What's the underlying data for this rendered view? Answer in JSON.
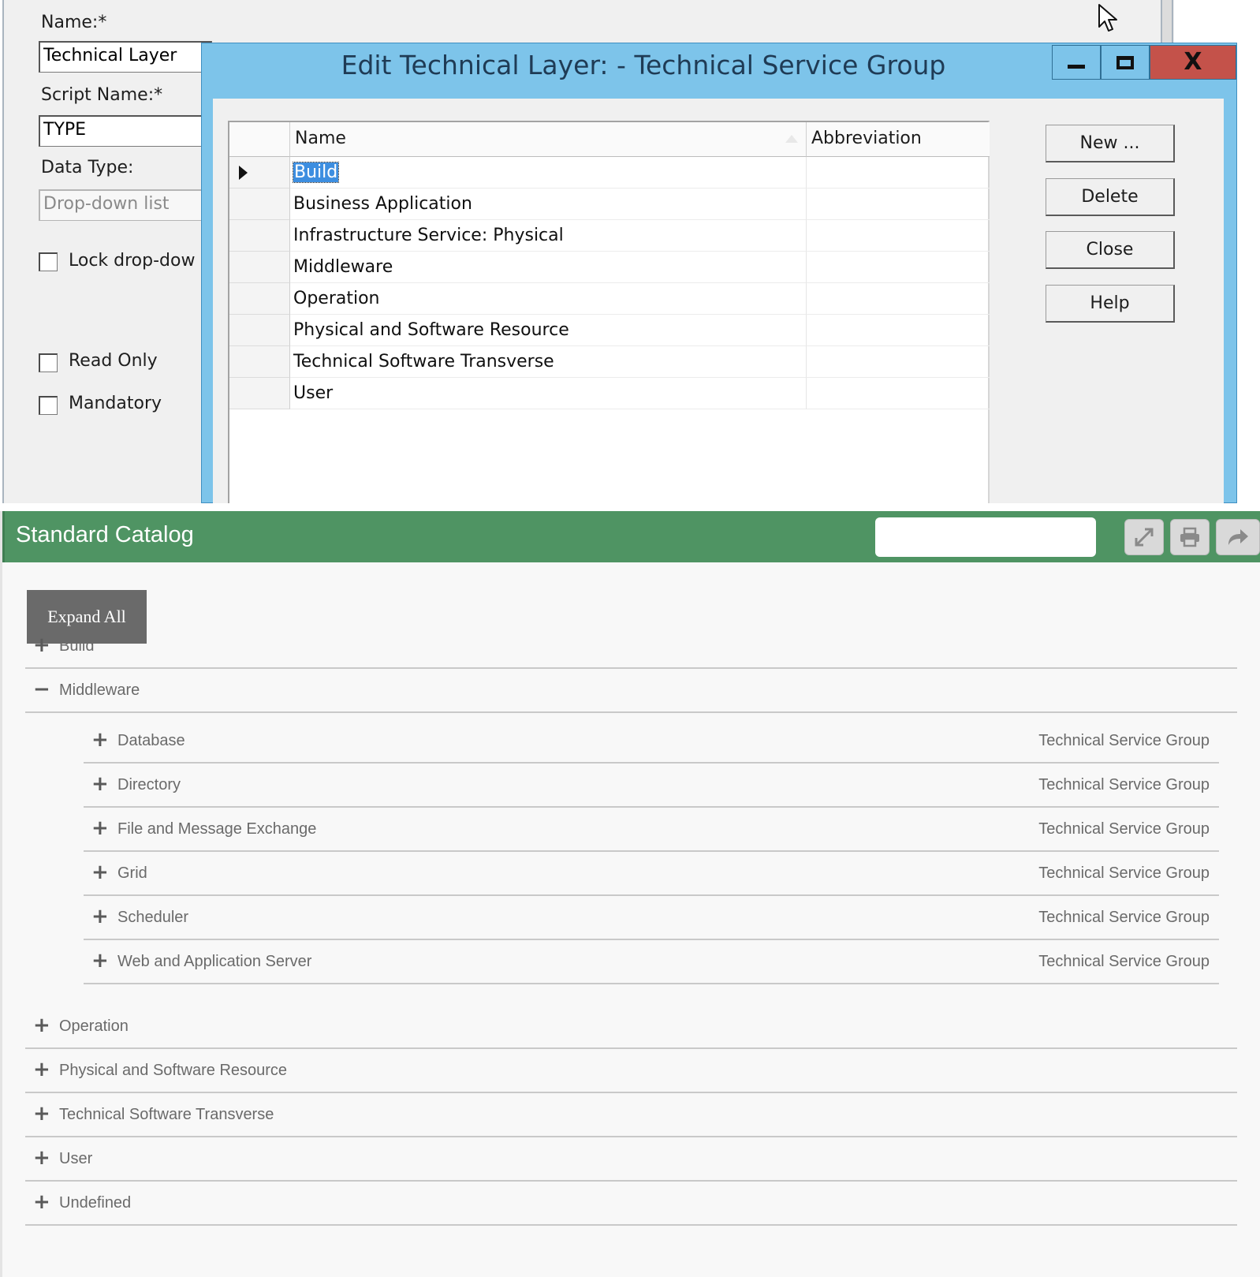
{
  "form": {
    "name_label": "Name:*",
    "name_value": "Technical Layer",
    "script_name_label": "Script Name:*",
    "script_name_value": "TYPE",
    "data_type_label": "Data Type:",
    "data_type_value": "Drop-down list",
    "lock_label": "Lock drop-dow",
    "read_only_label": "Read Only",
    "mandatory_label": "Mandatory"
  },
  "dialog": {
    "title": "Edit Technical Layer: - Technical Service Group",
    "close_glyph": "X",
    "columns": {
      "name": "Name",
      "abbreviation": "Abbreviation"
    },
    "rows": [
      {
        "name": "Build",
        "abbreviation": ""
      },
      {
        "name": "Business Application",
        "abbreviation": ""
      },
      {
        "name": "Infrastructure Service: Physical",
        "abbreviation": ""
      },
      {
        "name": "Middleware",
        "abbreviation": ""
      },
      {
        "name": "Operation",
        "abbreviation": ""
      },
      {
        "name": "Physical and Software Resource",
        "abbreviation": ""
      },
      {
        "name": "Technical Software Transverse",
        "abbreviation": ""
      },
      {
        "name": "User",
        "abbreviation": ""
      }
    ],
    "buttons": {
      "new": "New ...",
      "delete": "Delete",
      "close": "Close",
      "help": "Help"
    }
  },
  "catalog": {
    "title": "Standard Catalog",
    "search_placeholder": "",
    "expand_all": "Expand All",
    "colors": {
      "header": "#4f9463",
      "expand_button": "#6a6a6a"
    },
    "items": [
      {
        "label": "Build",
        "toggle": "+",
        "level": 1
      },
      {
        "label": "Middleware",
        "toggle": "−",
        "level": 1
      },
      {
        "label": "Database",
        "toggle": "+",
        "level": 2,
        "type": "Technical Service Group"
      },
      {
        "label": "Directory",
        "toggle": "+",
        "level": 2,
        "type": "Technical Service Group"
      },
      {
        "label": "File and Message Exchange",
        "toggle": "+",
        "level": 2,
        "type": "Technical Service Group"
      },
      {
        "label": "Grid",
        "toggle": "+",
        "level": 2,
        "type": "Technical Service Group"
      },
      {
        "label": "Scheduler",
        "toggle": "+",
        "level": 2,
        "type": "Technical Service Group"
      },
      {
        "label": "Web and Application Server",
        "toggle": "+",
        "level": 2,
        "type": "Technical Service Group"
      },
      {
        "label": "Operation",
        "toggle": "+",
        "level": 1
      },
      {
        "label": "Physical and Software Resource",
        "toggle": "+",
        "level": 1
      },
      {
        "label": "Technical Software Transverse",
        "toggle": "+",
        "level": 1
      },
      {
        "label": "User",
        "toggle": "+",
        "level": 1
      },
      {
        "label": "Undefined",
        "toggle": "+",
        "level": 1
      }
    ]
  }
}
